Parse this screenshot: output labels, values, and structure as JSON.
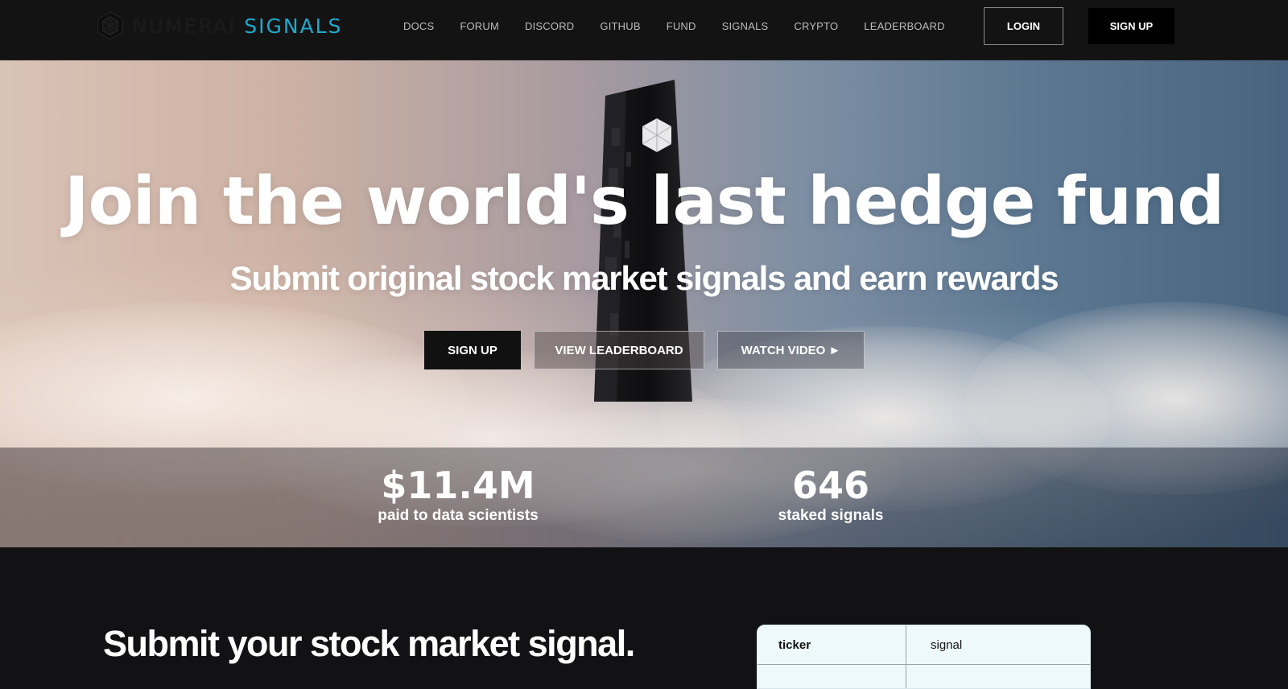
{
  "header": {
    "logo_word": "NUMERAI",
    "logo_accent": "SIGNALS",
    "nav": [
      "DOCS",
      "FORUM",
      "DISCORD",
      "GITHUB",
      "FUND",
      "SIGNALS",
      "CRYPTO",
      "LEADERBOARD"
    ],
    "login_label": "LOGIN",
    "signup_label": "SIGN UP"
  },
  "hero": {
    "title": "Join the world's last hedge fund",
    "subtitle": "Submit original stock market signals and earn rewards",
    "cta_signup": "SIGN UP",
    "cta_leaderboard": "VIEW LEADERBOARD",
    "cta_video": "WATCH VIDEO ►"
  },
  "stats": [
    {
      "value": "$11.4M",
      "label": "paid to data scientists"
    },
    {
      "value": "646",
      "label": "staked signals"
    }
  ],
  "section": {
    "title": "Submit your stock market signal.",
    "table_headers": [
      "ticker",
      "signal"
    ]
  },
  "colors": {
    "accent": "#1fa9cc",
    "header_bg": "#131313",
    "page_bg": "#121214"
  }
}
